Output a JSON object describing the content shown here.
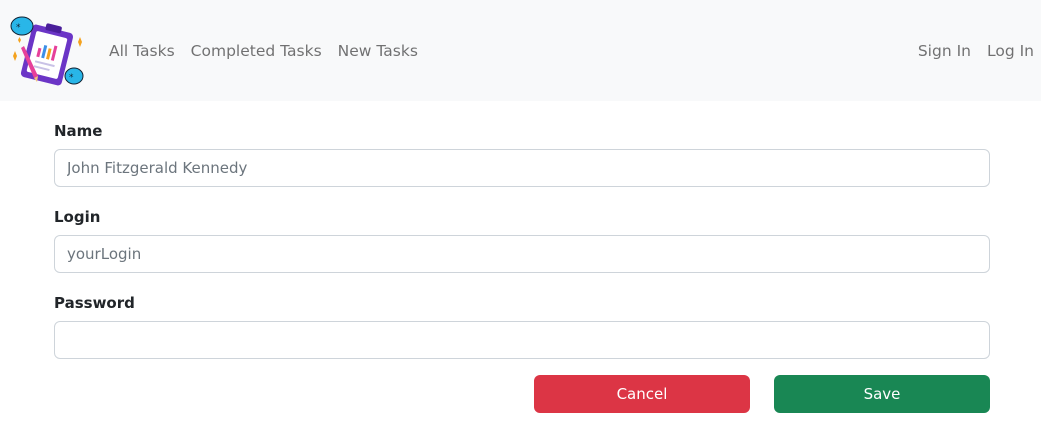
{
  "nav": {
    "left_links": [
      "All Tasks",
      "Completed Tasks",
      "New Tasks"
    ],
    "right_links": [
      "Sign In",
      "Log In"
    ]
  },
  "logo": {
    "icon": "clipboard-tasks-logo-icon"
  },
  "form": {
    "name_label": "Name",
    "name_placeholder": "John Fitzgerald Kennedy",
    "login_label": "Login",
    "login_placeholder": "yourLogin",
    "password_label": "Password",
    "password_placeholder": "",
    "cancel_label": "Cancel",
    "save_label": "Save"
  },
  "colors": {
    "navbar_bg": "#f8f9fa",
    "cancel": "#dc3545",
    "save": "#198754"
  }
}
